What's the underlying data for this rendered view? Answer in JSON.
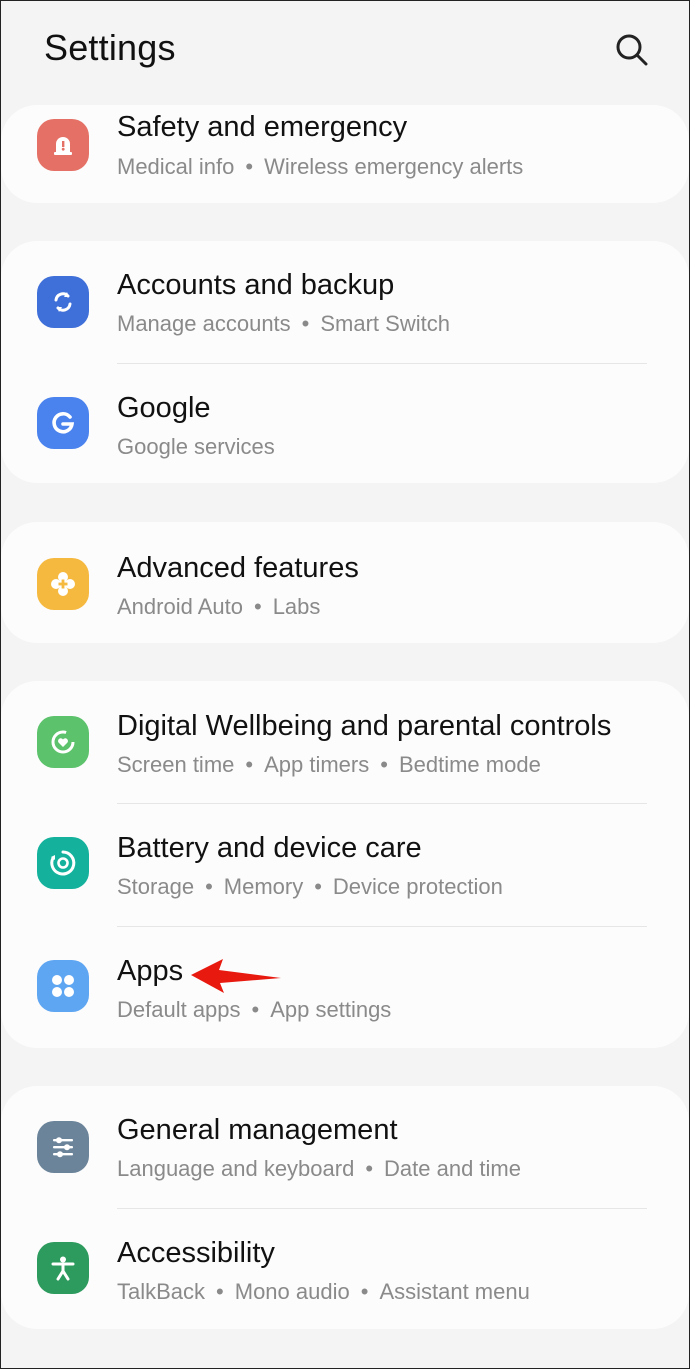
{
  "header": {
    "title": "Settings",
    "search_icon": "search-icon"
  },
  "items": {
    "safety": {
      "label": "Safety and emergency",
      "subs": [
        "Medical info",
        "Wireless emergency alerts"
      ],
      "icon": "siren-icon",
      "color": "#e57166"
    },
    "accounts": {
      "label": "Accounts and backup",
      "subs": [
        "Manage accounts",
        "Smart Switch"
      ],
      "icon": "sync-icon",
      "color": "#3f6fd8"
    },
    "google": {
      "label": "Google",
      "subs": [
        "Google services"
      ],
      "icon": "google-g-icon",
      "color": "#4a82ee"
    },
    "advanced": {
      "label": "Advanced features",
      "subs": [
        "Android Auto",
        "Labs"
      ],
      "icon": "plus-gear-icon",
      "color": "#f6b93f"
    },
    "wellbeing": {
      "label": "Digital Wellbeing and parental controls",
      "subs": [
        "Screen time",
        "App timers",
        "Bedtime mode"
      ],
      "icon": "heart-ring-icon",
      "color": "#5cc26b"
    },
    "battery": {
      "label": "Battery and device care",
      "subs": [
        "Storage",
        "Memory",
        "Device protection"
      ],
      "icon": "device-care-icon",
      "color": "#14b29c"
    },
    "apps": {
      "label": "Apps",
      "subs": [
        "Default apps",
        "App settings"
      ],
      "icon": "apps-grid-icon",
      "color": "#5fa6f2"
    },
    "general": {
      "label": "General management",
      "subs": [
        "Language and keyboard",
        "Date and time"
      ],
      "icon": "sliders-icon",
      "color": "#6b849a"
    },
    "accessibility": {
      "label": "Accessibility",
      "subs": [
        "TalkBack",
        "Mono audio",
        "Assistant menu"
      ],
      "icon": "accessibility-person-icon",
      "color": "#2d9b5d"
    }
  },
  "annotation": {
    "arrow_color": "#e8190f",
    "arrow_icon": "red-arrow-icon"
  }
}
